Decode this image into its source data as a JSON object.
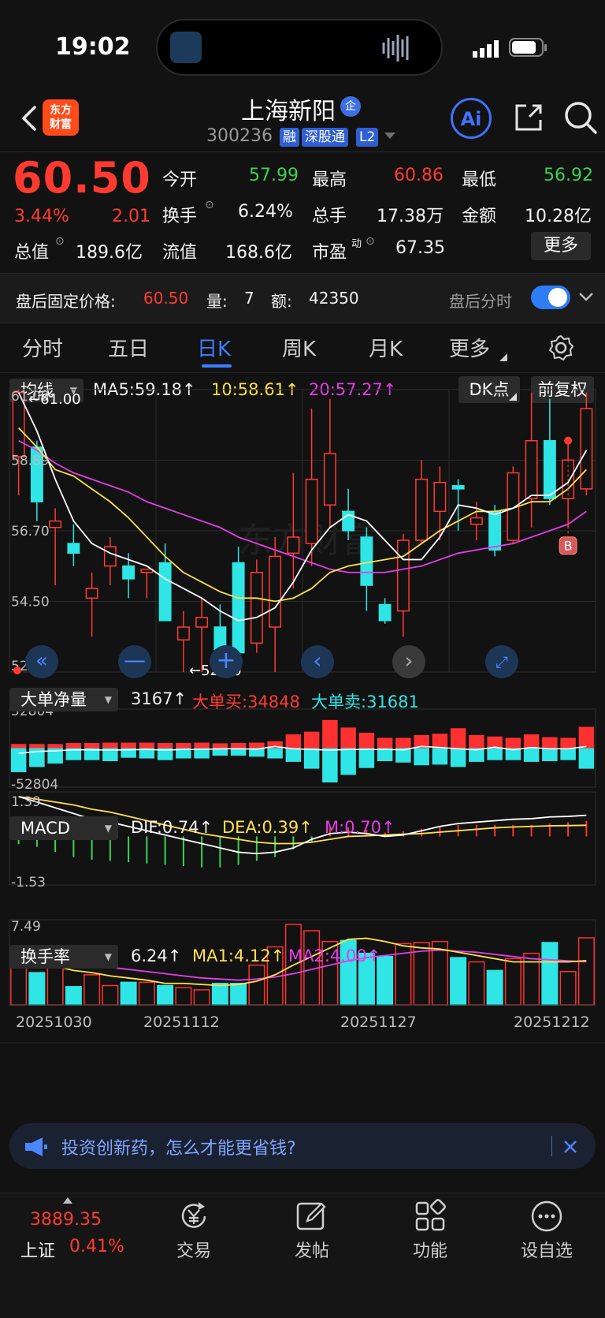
{
  "status_bar": {
    "time": "19:02"
  },
  "header": {
    "logo_text_1": "东方",
    "logo_text_2": "财富",
    "stock_name": "上海新阳",
    "enterprise_badge": "企",
    "stock_code": "300236",
    "tags": [
      "融",
      "深股通",
      "L2"
    ],
    "ai_label": "Ai"
  },
  "quote": {
    "price": "60.50",
    "change_pct": "3.44%",
    "change_amt": "2.01",
    "open_label": "今开",
    "open": "57.99",
    "high_label": "最高",
    "high": "60.86",
    "low_label": "最低",
    "low": "56.92",
    "turnover_label": "换手",
    "turnover": "6.24%",
    "volume_label": "总手",
    "volume": "17.38万",
    "amount_label": "金额",
    "amount": "10.28亿",
    "mcap_label": "总值",
    "mcap": "189.6亿",
    "float_label": "流值",
    "float_cap": "168.6亿",
    "pe_label": "市盈",
    "pe_sup": "动",
    "pe": "67.35",
    "more_label": "更多"
  },
  "after_hours": {
    "price_label": "盘后固定价格:",
    "price": "60.50",
    "vol_label": "量:",
    "vol": "7",
    "amt_label": "额:",
    "amt": "42350",
    "timeshare_label": "盘后分时"
  },
  "tabs": [
    "分时",
    "五日",
    "日K",
    "周K",
    "月K",
    "更多"
  ],
  "active_tab": "日K",
  "kline_header": {
    "selector": "均线",
    "ma5": "MA5:59.18↑",
    "ma10": "10:58.61↑",
    "ma20": "20:57.27↑",
    "dk_label": "DK点",
    "adjust_label": "前复权"
  },
  "kline_axis": {
    "y_labels": [
      "61.09",
      "58.89",
      "56.70",
      "54.50",
      "52.30"
    ],
    "high_mark": "←61.00",
    "low_mark": "←52.30",
    "buy_marker": "B",
    "watermark": "东方财富"
  },
  "bigorder_header": {
    "selector": "大单净量",
    "value": "3167↑",
    "buy": "大单买:34848",
    "sell": "大单卖:31681",
    "top": "52804",
    "bottom": "-52804"
  },
  "macd_header": {
    "selector": "MACD",
    "dif": "DIF:0.74↑",
    "dea": "DEA:0.39↑",
    "m": "M:0.70↑",
    "top": "1.39",
    "bottom": "-1.53"
  },
  "turnover_header": {
    "selector": "换手率",
    "value": "6.24↑",
    "ma1": "MA1:4.12↑",
    "ma2": "MA2:4.00↑",
    "top": "7.49"
  },
  "date_axis": [
    "20251030",
    "20251112",
    "20251127",
    "20251212"
  ],
  "notice": {
    "text": "投资创新药，怎么才能更省钱?"
  },
  "bottom_nav": {
    "index_value": "3889.35",
    "index_name": "上证",
    "index_change": "0.41%",
    "items": [
      "交易",
      "发帖",
      "功能",
      "设自选"
    ]
  },
  "chart_data": {
    "type": "candlestick",
    "ylim": [
      52.3,
      61.09
    ],
    "candles": [
      {
        "o": 59.0,
        "h": 61.09,
        "l": 57.8,
        "c": 61.0
      },
      {
        "o": 59.3,
        "h": 59.5,
        "l": 57.0,
        "c": 57.6
      },
      {
        "o": 56.8,
        "h": 57.4,
        "l": 55.0,
        "c": 57.0
      },
      {
        "o": 56.3,
        "h": 56.9,
        "l": 55.6,
        "c": 56.0
      },
      {
        "o": 54.6,
        "h": 55.4,
        "l": 53.4,
        "c": 54.9
      },
      {
        "o": 55.6,
        "h": 56.5,
        "l": 55.0,
        "c": 56.2
      },
      {
        "o": 55.6,
        "h": 56.0,
        "l": 54.6,
        "c": 55.2
      },
      {
        "o": 55.4,
        "h": 55.5,
        "l": 54.6,
        "c": 55.5
      },
      {
        "o": 55.7,
        "h": 56.3,
        "l": 53.9,
        "c": 53.9
      },
      {
        "o": 53.3,
        "h": 54.2,
        "l": 52.3,
        "c": 53.7
      },
      {
        "o": 53.7,
        "h": 54.6,
        "l": 52.3,
        "c": 54.0
      },
      {
        "o": 53.7,
        "h": 54.4,
        "l": 52.9,
        "c": 53.0
      },
      {
        "o": 55.7,
        "h": 56.2,
        "l": 52.8,
        "c": 52.9
      },
      {
        "o": 53.2,
        "h": 55.8,
        "l": 52.9,
        "c": 55.4
      },
      {
        "o": 53.7,
        "h": 56.5,
        "l": 52.3,
        "c": 55.9
      },
      {
        "o": 56.0,
        "h": 58.5,
        "l": 54.9,
        "c": 56.5
      },
      {
        "o": 56.3,
        "h": 60.5,
        "l": 55.6,
        "c": 58.3
      },
      {
        "o": 57.5,
        "h": 60.8,
        "l": 56.8,
        "c": 59.1
      },
      {
        "o": 57.3,
        "h": 58.0,
        "l": 56.4,
        "c": 56.7
      },
      {
        "o": 56.5,
        "h": 56.8,
        "l": 54.2,
        "c": 55.0
      },
      {
        "o": 54.4,
        "h": 54.6,
        "l": 53.8,
        "c": 53.9
      },
      {
        "o": 54.2,
        "h": 56.6,
        "l": 53.4,
        "c": 56.4
      },
      {
        "o": 56.4,
        "h": 58.9,
        "l": 56.3,
        "c": 58.3
      },
      {
        "o": 57.3,
        "h": 58.7,
        "l": 56.4,
        "c": 58.2
      },
      {
        "o": 58.1,
        "h": 58.3,
        "l": 56.7,
        "c": 58.0
      },
      {
        "o": 56.9,
        "h": 57.6,
        "l": 56.4,
        "c": 57.1
      },
      {
        "o": 57.3,
        "h": 57.5,
        "l": 55.9,
        "c": 56.1
      },
      {
        "o": 56.4,
        "h": 58.7,
        "l": 56.3,
        "c": 58.5
      },
      {
        "o": 57.7,
        "h": 61.0,
        "l": 56.8,
        "c": 59.5
      },
      {
        "o": 59.5,
        "h": 60.8,
        "l": 57.5,
        "c": 57.7
      },
      {
        "o": 57.7,
        "h": 59.6,
        "l": 56.8,
        "c": 58.9
      },
      {
        "o": 58.0,
        "h": 61.0,
        "l": 57.8,
        "c": 60.5
      }
    ],
    "ma5": [
      61.0,
      59.8,
      58.3,
      57.0,
      56.3,
      56.0,
      55.8,
      55.6,
      55.2,
      54.9,
      54.6,
      54.2,
      53.9,
      54.0,
      54.3,
      55.1,
      56.1,
      56.8,
      57.2,
      57.0,
      56.4,
      55.8,
      55.8,
      56.5,
      57.5,
      57.4,
      57.2,
      57.4,
      57.8,
      57.8,
      58.2,
      59.2
    ],
    "ma10": [
      59.9,
      59.3,
      58.6,
      58.4,
      58.0,
      57.6,
      57.1,
      56.5,
      55.9,
      55.4,
      55.1,
      54.8,
      54.6,
      54.6,
      54.5,
      54.6,
      54.9,
      55.4,
      55.6,
      55.7,
      55.8,
      55.9,
      56.3,
      56.7,
      57.0,
      57.3,
      57.3,
      57.4,
      57.6,
      57.6,
      58.0,
      58.6
    ],
    "ma20": [
      59.5,
      59.2,
      58.8,
      58.5,
      58.3,
      58.1,
      57.9,
      57.6,
      57.4,
      57.2,
      57.0,
      56.8,
      56.5,
      56.3,
      56.1,
      55.9,
      55.7,
      55.5,
      55.4,
      55.4,
      55.4,
      55.5,
      55.6,
      55.8,
      56.0,
      56.1,
      56.2,
      56.3,
      56.5,
      56.7,
      56.9,
      57.3
    ],
    "bigorder": {
      "ylim": [
        -52804,
        52804
      ],
      "buy": [
        0.12,
        0.12,
        0.12,
        0.15,
        0.15,
        0.16,
        0.16,
        0.16,
        0.15,
        0.15,
        0.16,
        0.14,
        0.15,
        0.16,
        0.2,
        0.4,
        0.48,
        0.82,
        0.6,
        0.45,
        0.3,
        0.3,
        0.38,
        0.42,
        0.58,
        0.38,
        0.34,
        0.3,
        0.4,
        0.32,
        0.3,
        0.62
      ],
      "sell": [
        0.7,
        0.55,
        0.45,
        0.35,
        0.35,
        0.38,
        0.28,
        0.3,
        0.35,
        0.3,
        0.3,
        0.22,
        0.22,
        0.25,
        0.3,
        0.4,
        0.6,
        1.0,
        0.78,
        0.58,
        0.38,
        0.42,
        0.5,
        0.48,
        0.55,
        0.4,
        0.35,
        0.35,
        0.4,
        0.38,
        0.35,
        0.6
      ],
      "net_line": [
        -0.15,
        -0.1,
        -0.08,
        -0.05,
        -0.05,
        -0.06,
        -0.05,
        -0.04,
        -0.06,
        -0.04,
        -0.04,
        -0.02,
        -0.02,
        -0.03,
        0.05,
        -0.02,
        -0.04,
        -0.06,
        -0.04,
        -0.04,
        -0.04,
        -0.05,
        0.05,
        0.02,
        -0.02,
        -0.05,
        0.03,
        -0.05,
        0.02,
        -0.02,
        -0.02,
        0.05
      ]
    },
    "macd": {
      "ylim": [
        -1.53,
        1.39
      ],
      "dif": [
        1.39,
        1.2,
        1.0,
        0.8,
        0.6,
        0.5,
        0.35,
        0.2,
        0.05,
        -0.1,
        -0.25,
        -0.4,
        -0.55,
        -0.6,
        -0.55,
        -0.4,
        -0.1,
        0.1,
        0.15,
        0.1,
        0.0,
        0.05,
        0.2,
        0.35,
        0.45,
        0.5,
        0.55,
        0.6,
        0.62,
        0.68,
        0.7,
        0.74
      ],
      "dea": [
        1.39,
        1.3,
        1.2,
        1.1,
        0.95,
        0.85,
        0.7,
        0.55,
        0.4,
        0.25,
        0.1,
        0.0,
        -0.1,
        -0.2,
        -0.25,
        -0.25,
        -0.2,
        -0.1,
        0.0,
        0.02,
        0.05,
        0.08,
        0.1,
        0.15,
        0.2,
        0.25,
        0.3,
        0.33,
        0.35,
        0.37,
        0.38,
        0.39
      ],
      "hist": [
        -0.3,
        -0.4,
        -0.6,
        -0.8,
        -0.9,
        -0.95,
        -1.0,
        -1.05,
        -1.1,
        -1.15,
        -1.2,
        -1.2,
        -1.1,
        -0.95,
        -0.8,
        -0.5,
        -0.2,
        0.35,
        0.35,
        0.25,
        0.15,
        0.2,
        0.3,
        0.4,
        0.45,
        0.45,
        0.45,
        0.45,
        0.45,
        0.5,
        0.55,
        0.6
      ]
    },
    "turnover": {
      "ylim": [
        0,
        7.49
      ],
      "values": [
        5.0,
        3.0,
        3.8,
        1.7,
        2.8,
        1.8,
        2.1,
        2.1,
        1.8,
        1.6,
        1.4,
        2.0,
        2.0,
        3.7,
        5.4,
        7.49,
        6.9,
        5.9,
        6.0,
        4.8,
        4.5,
        5.7,
        5.8,
        5.9,
        4.4,
        4.0,
        3.2,
        4.3,
        4.8,
        5.8,
        3.1,
        6.24
      ],
      "ma1": [
        4.2,
        3.9,
        3.6,
        3.2,
        3.0,
        2.7,
        2.5,
        2.3,
        2.0,
        2.0,
        1.9,
        1.8,
        1.9,
        2.2,
        2.8,
        3.7,
        4.5,
        5.3,
        6.1,
        6.2,
        5.9,
        5.5,
        5.3,
        5.2,
        4.9,
        4.6,
        4.3,
        4.0,
        4.0,
        4.0,
        4.0,
        4.12
      ],
      "ma2": [
        4.6,
        4.4,
        4.2,
        4.0,
        3.8,
        3.5,
        3.3,
        3.1,
        2.9,
        2.7,
        2.5,
        2.4,
        2.3,
        2.4,
        2.6,
        2.9,
        3.3,
        3.7,
        4.1,
        4.4,
        4.6,
        4.8,
        5.0,
        5.1,
        5.0,
        4.9,
        4.7,
        4.5,
        4.3,
        4.2,
        4.1,
        4.0
      ]
    },
    "up_color": "#ff3b30",
    "down_color": "#2fe5e5",
    "ma5_color": "#ffffff",
    "ma10_color": "#ffe14a",
    "ma20_color": "#e23ee6"
  }
}
